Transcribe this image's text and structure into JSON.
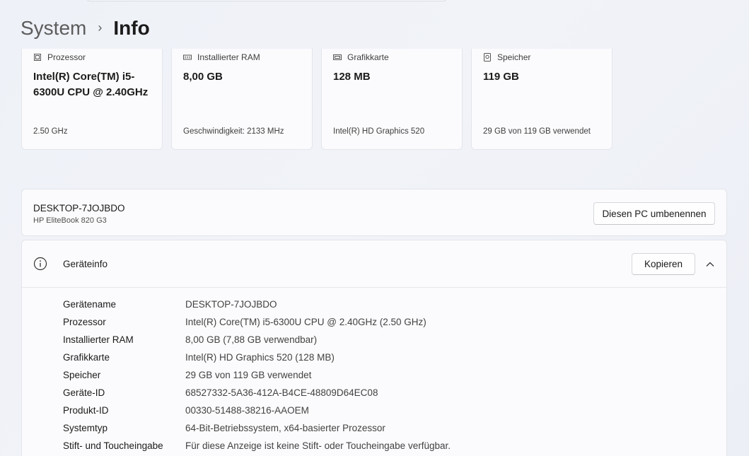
{
  "breadcrumb": {
    "parent": "System",
    "separator": "›",
    "current": "Info"
  },
  "cards": [
    {
      "icon": "processor-icon",
      "label": "Prozessor",
      "value": "Intel(R) Core(TM) i5-6300U CPU @ 2.40GHz",
      "sub": "2.50 GHz"
    },
    {
      "icon": "ram-icon",
      "label": "Installierter RAM",
      "value": "8,00 GB",
      "sub": "Geschwindigkeit: 2133 MHz"
    },
    {
      "icon": "graphics-card-icon",
      "label": "Grafikkarte",
      "value": "128 MB",
      "sub": "Intel(R) HD Graphics 520"
    },
    {
      "icon": "storage-icon",
      "label": "Speicher",
      "value": "119 GB",
      "sub": "29 GB von 119 GB verwendet"
    }
  ],
  "pc": {
    "name": "DESKTOP-7JOJBDO",
    "model": "HP EliteBook 820 G3",
    "rename_label": "Diesen PC umbenennen"
  },
  "device_info": {
    "title": "Geräteinfo",
    "copy_label": "Kopieren",
    "rows": [
      {
        "key": "Gerätename",
        "value": "DESKTOP-7JOJBDO"
      },
      {
        "key": "Prozessor",
        "value": "Intel(R) Core(TM) i5-6300U CPU @ 2.40GHz (2.50 GHz)"
      },
      {
        "key": "Installierter RAM",
        "value": "8,00 GB (7,88 GB verwendbar)"
      },
      {
        "key": "Grafikkarte",
        "value": "Intel(R) HD Graphics 520 (128 MB)"
      },
      {
        "key": "Speicher",
        "value": "29 GB von 119 GB verwendet"
      },
      {
        "key": "Geräte-ID",
        "value": "68527332-5A36-412A-B4CE-48809D64EC08"
      },
      {
        "key": "Produkt-ID",
        "value": "00330-51488-38216-AAOEM"
      },
      {
        "key": "Systemtyp",
        "value": "64-Bit-Betriebssystem, x64-basierter Prozessor"
      },
      {
        "key": "Stift- und Toucheingabe",
        "value": "Für diese Anzeige ist keine Stift- oder Toucheingabe verfügbar."
      }
    ]
  }
}
